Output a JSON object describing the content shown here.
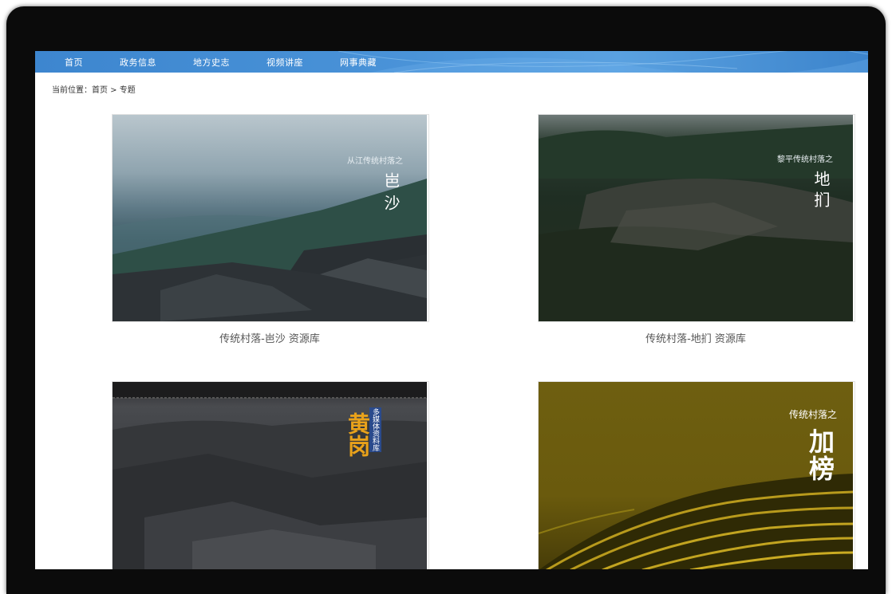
{
  "nav": {
    "items": [
      {
        "label": "首页"
      },
      {
        "label": "政务信息"
      },
      {
        "label": "地方史志"
      },
      {
        "label": "视频讲座"
      },
      {
        "label": "网事典藏"
      }
    ]
  },
  "breadcrumb": {
    "prefix": "当前位置：",
    "home": "首页",
    "separator": " > ",
    "current": "专题"
  },
  "cards": [
    {
      "subtitle": "从江传统村落之",
      "title": "岜沙",
      "caption": "传统村落-岜沙 资源库"
    },
    {
      "subtitle": "黎平传统村落之",
      "title": "地扪",
      "caption": "传统村落-地扪 资源库"
    },
    {
      "subtitle": "多媒体资料库",
      "title": "黄岗"
    },
    {
      "subtitle": "传统村落之",
      "title": "加榜"
    }
  ],
  "colors": {
    "nav_bg": "#4a93d8",
    "gold_title": "#e9a21a"
  }
}
